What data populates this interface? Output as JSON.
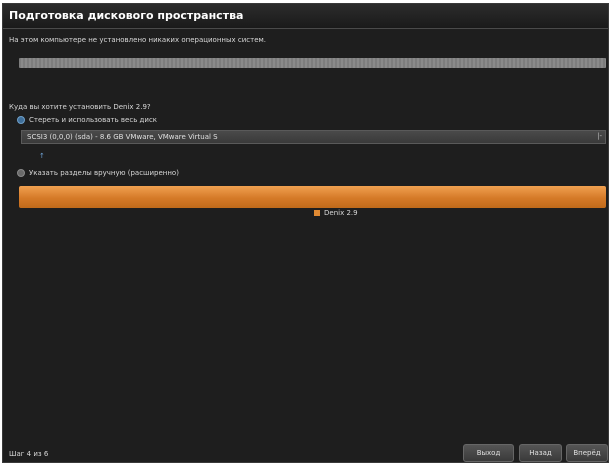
{
  "window": {
    "title": "Подготовка дискового пространства"
  },
  "info": {
    "no_os": "На этом компьютере не установлено никаких операционных систем."
  },
  "install": {
    "question": "Куда вы хотите установить Denix 2.9?",
    "options": [
      {
        "label": "Стереть и использовать весь диск",
        "selected": true
      },
      {
        "label": "Указать разделы вручную (расширенно)",
        "selected": false
      }
    ],
    "disk_select_value": "SCSI3 (0,0,0) (sda) - 8.6 GB VMware, VMware Virtual S"
  },
  "partition_legend": {
    "label": "Denix 2.9",
    "color": "#e08a33"
  },
  "footer": {
    "step": "Шаг 4 из 6",
    "buttons": {
      "quit": "Выход",
      "back": "Назад",
      "forward": "Вперёд"
    }
  },
  "icons": {
    "disk_select_arrow": "chevron-down-icon",
    "small": "info-icon"
  }
}
